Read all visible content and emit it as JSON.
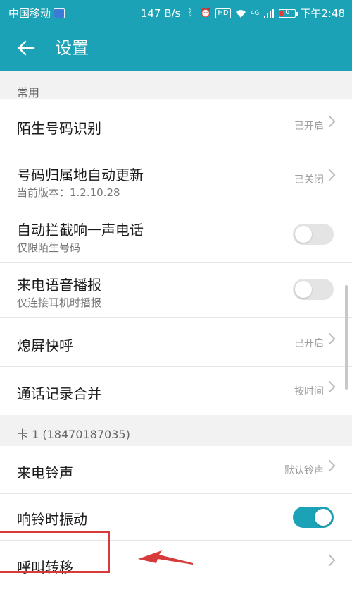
{
  "status_bar": {
    "carrier": "中国移动",
    "net_speed": "147 B/s",
    "signal_label": "4G",
    "battery_level": "6",
    "time": "下午2:48",
    "icons": [
      "sim-icon",
      "bluetooth-icon",
      "alarm-icon",
      "hd-icon",
      "wifi-icon",
      "signal-icon",
      "battery-icon"
    ],
    "colors": {
      "bar_bg": "#1ba2b7",
      "battery_low": "#e53935"
    }
  },
  "app_bar": {
    "title": "设置",
    "back_icon": "arrow-left-icon"
  },
  "sections": {
    "common": {
      "header": "常用",
      "items": [
        {
          "title": "陌生号码识别",
          "value": "已开启"
        },
        {
          "title": "号码归属地自动更新",
          "subtitle": "当前版本：1.2.10.28",
          "value": "已关闭"
        },
        {
          "title": "自动拦截响一声电话",
          "subtitle": "仅限陌生号码",
          "toggle": "off"
        },
        {
          "title": "来电语音播报",
          "subtitle": "仅连接耳机时播报",
          "toggle": "off"
        },
        {
          "title": "熄屏快呼",
          "value": "已开启"
        },
        {
          "title": "通话记录合并",
          "value": "按时间"
        }
      ]
    },
    "card1": {
      "header": "卡 1 (18470187035)",
      "items": [
        {
          "title": "来电铃声",
          "value": "默认铃声"
        },
        {
          "title": "响铃时振动",
          "toggle": "on"
        },
        {
          "title": "呼叫转移"
        }
      ]
    }
  },
  "colors": {
    "accent": "#1ba2b7",
    "annotation": "#d63a3a",
    "toggle_off": "#e4e4e4"
  }
}
